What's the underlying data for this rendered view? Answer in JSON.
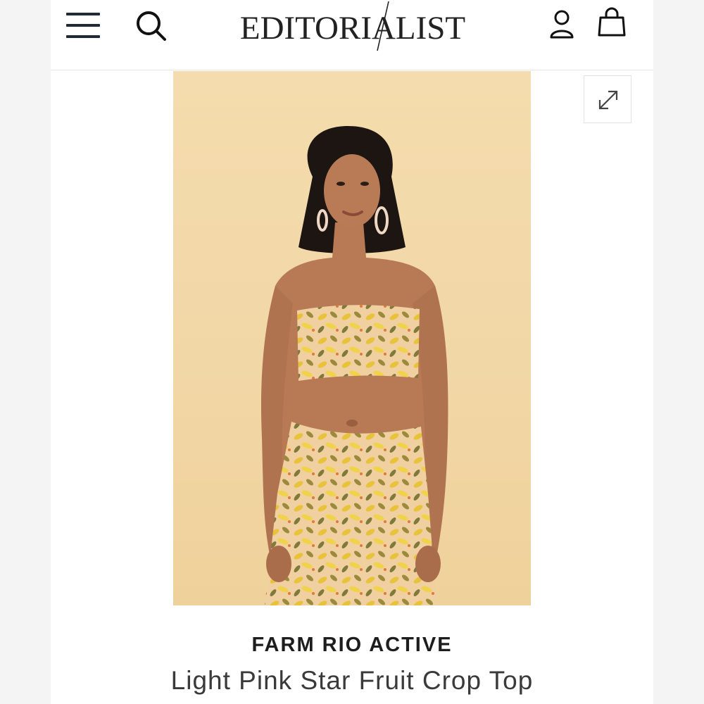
{
  "header": {
    "logo_text": "EDITORIALIST",
    "icons": [
      "menu-icon",
      "search-icon",
      "account-icon",
      "bag-icon"
    ]
  },
  "product": {
    "image_alt": "Model wearing a strapless printed crop top with matching skirt",
    "brand": "FARM RIO ACTIVE",
    "title": "Light Pink Star Fruit Crop Top"
  },
  "controls": {
    "expand_icon": "expand-icon"
  },
  "colors": {
    "background": "#ffffff",
    "photo_backdrop": "#f3d9aa",
    "text_dark": "#1d1d1d",
    "icon_dark": "#1f2a36"
  }
}
